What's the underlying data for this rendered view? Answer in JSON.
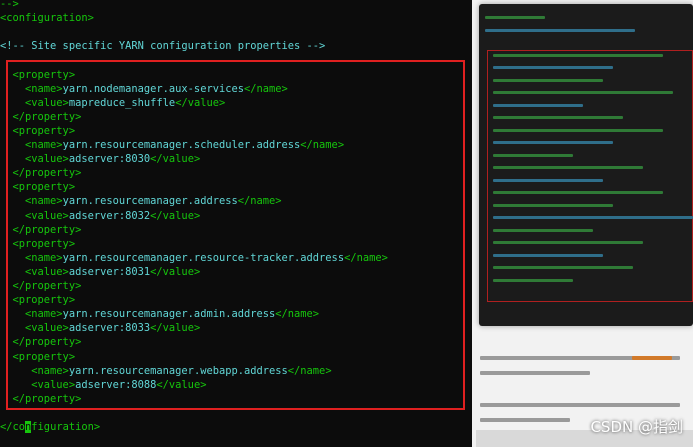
{
  "terminal": {
    "lines": [
      {
        "segments": [
          {
            "t": "-->",
            "c": "tag"
          }
        ]
      },
      {
        "segments": [
          {
            "t": "<configuration>",
            "c": "tag"
          }
        ]
      },
      {
        "segments": [
          {
            "t": "",
            "c": "tag"
          }
        ]
      },
      {
        "segments": [
          {
            "t": "<!-- Site specific YARN configuration properties -->",
            "c": "cmt"
          }
        ]
      },
      {
        "segments": [
          {
            "t": "",
            "c": "tag"
          }
        ]
      },
      {
        "segments": [
          {
            "t": "  <property>",
            "c": "tag"
          }
        ]
      },
      {
        "segments": [
          {
            "t": "    <name>",
            "c": "tag"
          },
          {
            "t": "yarn.nodemanager.aux-services",
            "c": "txt"
          },
          {
            "t": "</name>",
            "c": "tag"
          }
        ]
      },
      {
        "segments": [
          {
            "t": "    <value>",
            "c": "tag"
          },
          {
            "t": "mapreduce_shuffle",
            "c": "txt"
          },
          {
            "t": "</value>",
            "c": "tag"
          }
        ]
      },
      {
        "segments": [
          {
            "t": "  </property>",
            "c": "tag"
          }
        ]
      },
      {
        "segments": [
          {
            "t": "  <property>",
            "c": "tag"
          }
        ]
      },
      {
        "segments": [
          {
            "t": "    <name>",
            "c": "tag"
          },
          {
            "t": "yarn.resourcemanager.scheduler.address",
            "c": "txt"
          },
          {
            "t": "</name>",
            "c": "tag"
          }
        ]
      },
      {
        "segments": [
          {
            "t": "    <value>",
            "c": "tag"
          },
          {
            "t": "adserver:8030",
            "c": "txt"
          },
          {
            "t": "</value>",
            "c": "tag"
          }
        ]
      },
      {
        "segments": [
          {
            "t": "  </property>",
            "c": "tag"
          }
        ]
      },
      {
        "segments": [
          {
            "t": "  <property>",
            "c": "tag"
          }
        ]
      },
      {
        "segments": [
          {
            "t": "    <name>",
            "c": "tag"
          },
          {
            "t": "yarn.resourcemanager.address",
            "c": "txt"
          },
          {
            "t": "</name>",
            "c": "tag"
          }
        ]
      },
      {
        "segments": [
          {
            "t": "    <value>",
            "c": "tag"
          },
          {
            "t": "adserver:8032",
            "c": "txt"
          },
          {
            "t": "</value>",
            "c": "tag"
          }
        ]
      },
      {
        "segments": [
          {
            "t": "  </property>",
            "c": "tag"
          }
        ]
      },
      {
        "segments": [
          {
            "t": "  <property>",
            "c": "tag"
          }
        ]
      },
      {
        "segments": [
          {
            "t": "    <name>",
            "c": "tag"
          },
          {
            "t": "yarn.resourcemanager.resource-tracker.address",
            "c": "txt"
          },
          {
            "t": "</name>",
            "c": "tag"
          }
        ]
      },
      {
        "segments": [
          {
            "t": "    <value>",
            "c": "tag"
          },
          {
            "t": "adserver:8031",
            "c": "txt"
          },
          {
            "t": "</value>",
            "c": "tag"
          }
        ]
      },
      {
        "segments": [
          {
            "t": "  </property>",
            "c": "tag"
          }
        ]
      },
      {
        "segments": [
          {
            "t": "  <property>",
            "c": "tag"
          }
        ]
      },
      {
        "segments": [
          {
            "t": "    <name>",
            "c": "tag"
          },
          {
            "t": "yarn.resourcemanager.admin.address",
            "c": "txt"
          },
          {
            "t": "</name>",
            "c": "tag"
          }
        ]
      },
      {
        "segments": [
          {
            "t": "    <value>",
            "c": "tag"
          },
          {
            "t": "adserver:8033",
            "c": "txt"
          },
          {
            "t": "</value>",
            "c": "tag"
          }
        ]
      },
      {
        "segments": [
          {
            "t": "  </property>",
            "c": "tag"
          }
        ]
      },
      {
        "segments": [
          {
            "t": "  <property>",
            "c": "tag"
          }
        ]
      },
      {
        "segments": [
          {
            "t": "     <name>",
            "c": "tag"
          },
          {
            "t": "yarn.resourcemanager.webapp.address",
            "c": "txt"
          },
          {
            "t": "</name>",
            "c": "tag"
          }
        ]
      },
      {
        "segments": [
          {
            "t": "     <value>",
            "c": "tag"
          },
          {
            "t": "adserver:8088",
            "c": "txt"
          },
          {
            "t": "</value>",
            "c": "tag"
          }
        ]
      },
      {
        "segments": [
          {
            "t": "  </property>",
            "c": "tag"
          }
        ]
      },
      {
        "segments": [
          {
            "t": "",
            "c": "tag"
          }
        ]
      },
      {
        "segments": [
          {
            "t": "</co",
            "c": "tag"
          },
          {
            "t": "n",
            "c": "cursor"
          },
          {
            "t": "figuration>",
            "c": "tag"
          }
        ]
      }
    ]
  },
  "watermark": "CSDN @指剑",
  "colors": {
    "tag": "#16c60c",
    "text": "#61d6d6",
    "highlight_border": "#e02020",
    "background": "#0c0c0c"
  }
}
